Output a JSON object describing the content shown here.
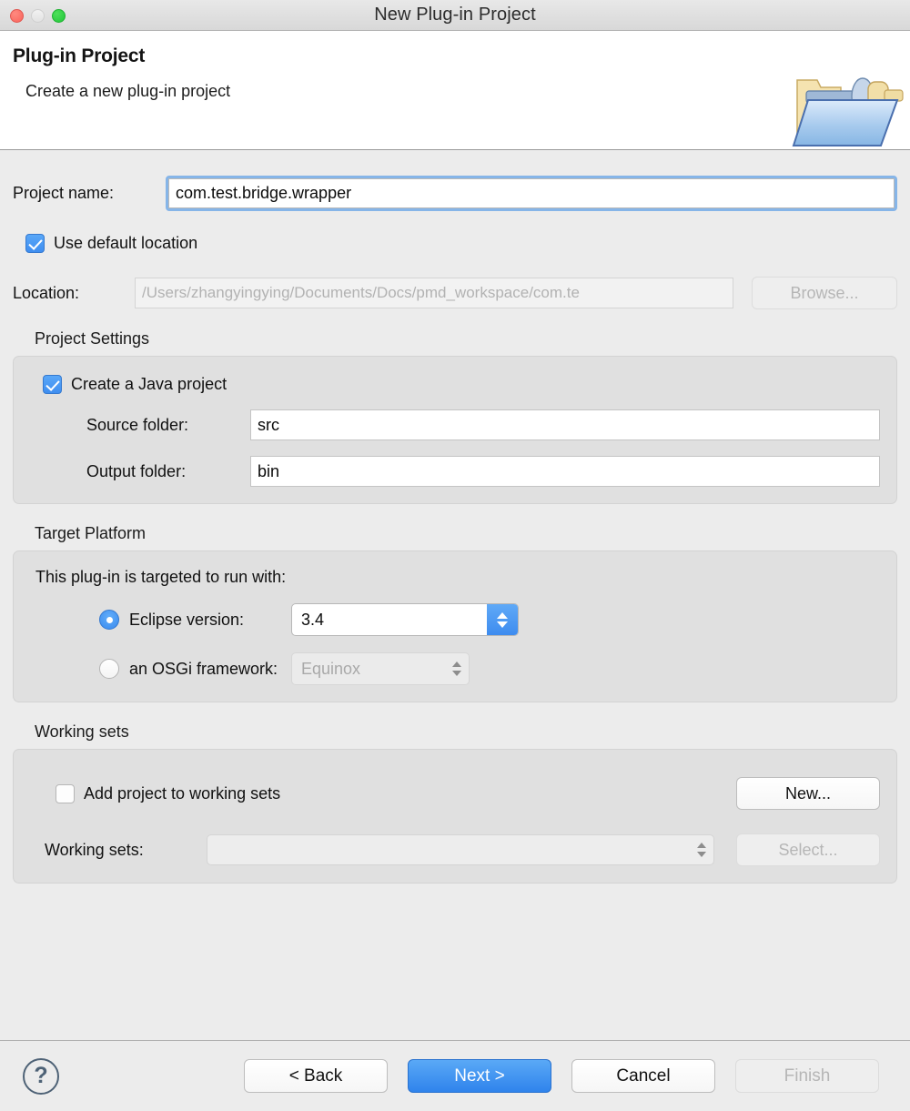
{
  "window": {
    "title": "New Plug-in Project",
    "traffic_lights": [
      {
        "name": "close",
        "color": "#f9645c",
        "enabled": true
      },
      {
        "name": "minimize",
        "color": "#e8e8e8",
        "enabled": false
      },
      {
        "name": "maximize",
        "color": "#22c639",
        "enabled": true
      }
    ]
  },
  "banner": {
    "title": "Plug-in Project",
    "subtitle": "Create a new plug-in project",
    "icon": "plugin-folder-icon"
  },
  "form": {
    "project_name_label": "Project name:",
    "project_name_value": "com.test.bridge.wrapper",
    "project_name_focused": true,
    "use_default_location_label": "Use default location",
    "use_default_location_checked": true,
    "location_label": "Location:",
    "location_value": "/Users/zhangyingying/Documents/Docs/pmd_workspace/com.te",
    "location_enabled": false,
    "browse_label": "Browse...",
    "browse_enabled": false
  },
  "project_settings": {
    "group_title": "Project Settings",
    "create_java_project_label": "Create a Java project",
    "create_java_project_checked": true,
    "source_folder_label": "Source folder:",
    "source_folder_value": "src",
    "output_folder_label": "Output folder:",
    "output_folder_value": "bin"
  },
  "target_platform": {
    "group_title": "Target Platform",
    "intro": "This plug-in is targeted to run with:",
    "eclipse_radio_label": "Eclipse version:",
    "eclipse_radio_selected": true,
    "eclipse_version_value": "3.4",
    "osgi_radio_label": "an OSGi framework:",
    "osgi_radio_selected": false,
    "osgi_framework_value": "Equinox",
    "osgi_framework_enabled": false
  },
  "working_sets": {
    "group_title": "Working sets",
    "add_project_label": "Add project to working sets",
    "add_project_checked": false,
    "new_button_label": "New...",
    "working_sets_label": "Working sets:",
    "working_sets_value": "",
    "working_sets_enabled": false,
    "select_button_label": "Select...",
    "select_button_enabled": false
  },
  "footer": {
    "help_glyph": "?",
    "back_label": "< Back",
    "next_label": "Next >",
    "cancel_label": "Cancel",
    "finish_label": "Finish",
    "finish_enabled": false,
    "default_button": "Next >"
  },
  "colors": {
    "accent": "#3f8ef0",
    "window_bg": "#ececec",
    "panel_bg": "#e0e0e0",
    "focus_ring": "#86b5e8"
  }
}
